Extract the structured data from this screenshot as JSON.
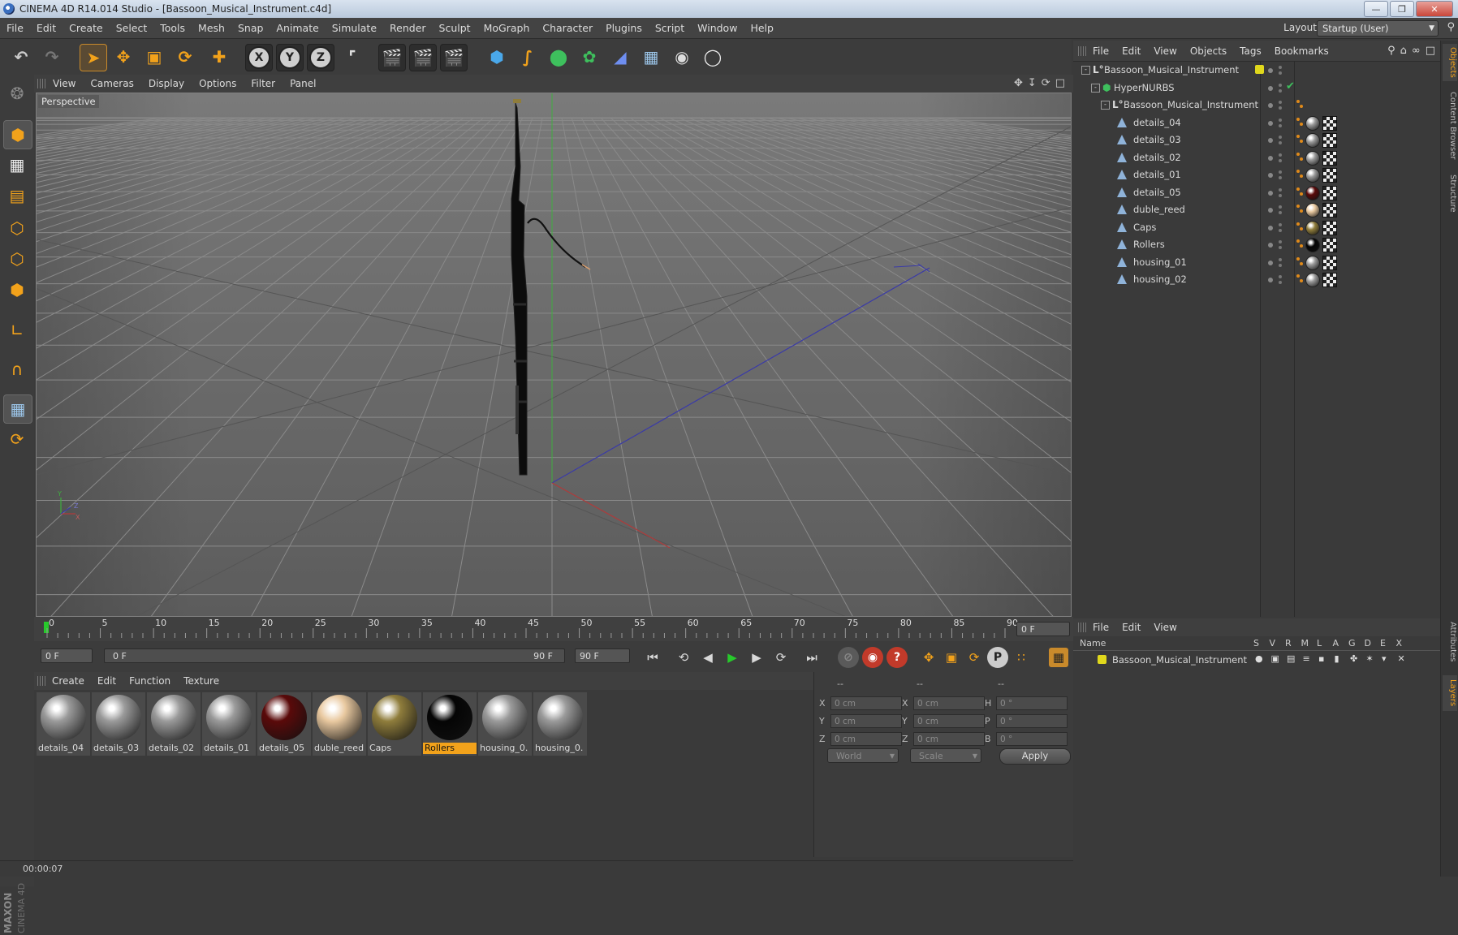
{
  "window": {
    "title": "CINEMA 4D R14.014 Studio - [Bassoon_Musical_Instrument.c4d]"
  },
  "menu": [
    "File",
    "Edit",
    "Create",
    "Select",
    "Tools",
    "Mesh",
    "Snap",
    "Animate",
    "Simulate",
    "Render",
    "Sculpt",
    "MoGraph",
    "Character",
    "Plugins",
    "Script",
    "Window",
    "Help"
  ],
  "layout": {
    "label": "Layout:",
    "value": "Startup (User)"
  },
  "viewport": {
    "menu": [
      "View",
      "Cameras",
      "Display",
      "Options",
      "Filter",
      "Panel"
    ],
    "label": "Perspective"
  },
  "timeline": {
    "ticks": [
      "0",
      "5",
      "10",
      "15",
      "20",
      "25",
      "30",
      "35",
      "40",
      "45",
      "50",
      "55",
      "60",
      "65",
      "70",
      "75",
      "80",
      "85",
      "90"
    ],
    "current_frame": "0 F",
    "start_field": "0 F",
    "range_start": "0 F",
    "range_end": "90 F",
    "end_field": "90 F"
  },
  "materials": {
    "menu": [
      "Create",
      "Edit",
      "Function",
      "Texture"
    ],
    "items": [
      {
        "label": "details_04",
        "color": "#9a9a9a"
      },
      {
        "label": "details_03",
        "color": "#9a9a9a"
      },
      {
        "label": "details_02",
        "color": "#9a9a9a"
      },
      {
        "label": "details_01",
        "color": "#9a9a9a"
      },
      {
        "label": "details_05",
        "color": "#5a0a0a"
      },
      {
        "label": "duble_reed",
        "color": "#e9c9a0"
      },
      {
        "label": "Caps",
        "color": "#8f7d3c"
      },
      {
        "label": "Rollers",
        "color": "#050505"
      },
      {
        "label": "housing_0.",
        "color": "#9a9a9a"
      },
      {
        "label": "housing_0.",
        "color": "#9a9a9a"
      }
    ]
  },
  "coordinates": {
    "headers": [
      "--",
      "--",
      "--"
    ],
    "rows": [
      {
        "a": "X",
        "av": "0 cm",
        "b": "X",
        "bv": "0 cm",
        "c": "H",
        "cv": "0 °"
      },
      {
        "a": "Y",
        "av": "0 cm",
        "b": "Y",
        "bv": "0 cm",
        "c": "P",
        "cv": "0 °"
      },
      {
        "a": "Z",
        "av": "0 cm",
        "b": "Z",
        "bv": "0 cm",
        "c": "B",
        "cv": "0 °"
      }
    ],
    "mode1": "World",
    "mode2": "Scale",
    "apply": "Apply"
  },
  "objects": {
    "menu": [
      "File",
      "Edit",
      "View",
      "Objects",
      "Tags",
      "Bookmarks"
    ],
    "tree": [
      {
        "name": "Bassoon_Musical_Instrument",
        "type": "null",
        "indent": 0
      },
      {
        "name": "HyperNURBS",
        "type": "hypernurbs",
        "indent": 1
      },
      {
        "name": "Bassoon_Musical_Instrument",
        "type": "null",
        "indent": 2
      },
      {
        "name": "details_04",
        "type": "poly",
        "indent": 3,
        "mat": "#9a9a9a"
      },
      {
        "name": "details_03",
        "type": "poly",
        "indent": 3,
        "mat": "#9a9a9a"
      },
      {
        "name": "details_02",
        "type": "poly",
        "indent": 3,
        "mat": "#9a9a9a"
      },
      {
        "name": "details_01",
        "type": "poly",
        "indent": 3,
        "mat": "#9a9a9a"
      },
      {
        "name": "details_05",
        "type": "poly",
        "indent": 3,
        "mat": "#5a0a0a"
      },
      {
        "name": "duble_reed",
        "type": "poly",
        "indent": 3,
        "mat": "#e9c9a0"
      },
      {
        "name": "Caps",
        "type": "poly",
        "indent": 3,
        "mat": "#8f7d3c"
      },
      {
        "name": "Rollers",
        "type": "poly",
        "indent": 3,
        "mat": "#050505"
      },
      {
        "name": "housing_01",
        "type": "poly",
        "indent": 3,
        "mat": "#9a9a9a"
      },
      {
        "name": "housing_02",
        "type": "poly",
        "indent": 3,
        "mat": "#9a9a9a"
      }
    ]
  },
  "layers": {
    "menu": [
      "File",
      "Edit",
      "View"
    ],
    "columns": [
      "Name",
      "S",
      "V",
      "R",
      "M",
      "L",
      "A",
      "G",
      "D",
      "E",
      "X"
    ],
    "items": [
      {
        "name": "Bassoon_Musical_Instrument",
        "color": "#e0d81c"
      }
    ]
  },
  "right_tabs": [
    "Objects",
    "Content Browser",
    "Structure",
    "Attributes",
    "Layers"
  ],
  "status": {
    "time": "00:00:07"
  },
  "brand": {
    "logo": "MAXON CINEMA 4D"
  },
  "colors": {
    "accent": "#f2a21b",
    "play": "#27c92b"
  }
}
